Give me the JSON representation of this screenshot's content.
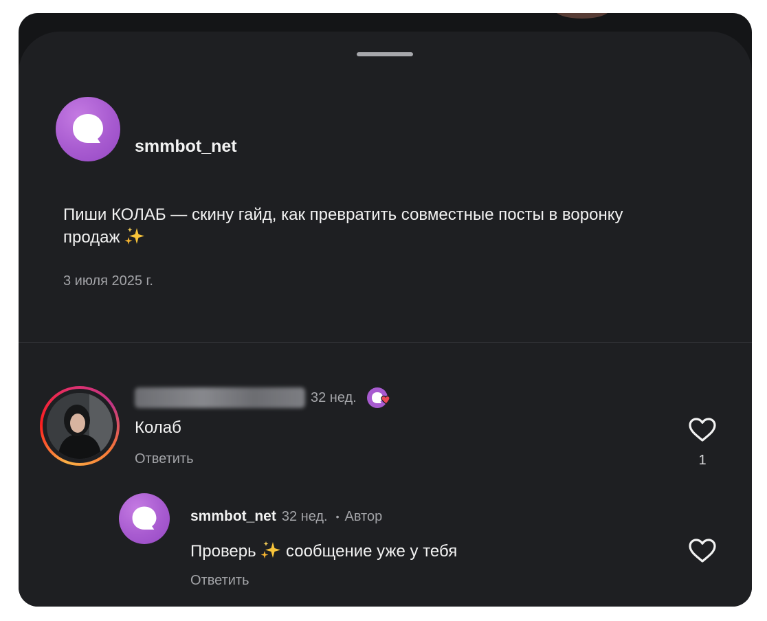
{
  "post": {
    "author": "smmbot_net",
    "text": "Пиши КОЛАБ — скину гайд, как превратить совместные посты в воронку продаж",
    "date": "3 июля 2025 г."
  },
  "comments": [
    {
      "author": "mahabat.marketolog",
      "time": "32 нед.",
      "text": "Колаб",
      "reply_label": "Ответить",
      "likes": "1"
    }
  ],
  "reply": {
    "author": "smmbot_net",
    "time": "32 нед.",
    "separator": "•",
    "author_badge": "Автор",
    "text_before": "Проверь",
    "text_after": "сообщение уже у тебя",
    "reply_label": "Ответить"
  },
  "icons": {
    "brand_logo": "speech-bubble-logo",
    "like": "heart-outline-icon",
    "author_liked": "author-like-badge-icon",
    "emoji": "sparkles-emoji"
  },
  "colors": {
    "brand_purple": "#a85bd0",
    "sheet_background": "#1e1f22",
    "primary_text": "#f2f2f2",
    "secondary_text": "#a3a4a8",
    "like_red": "#ed4956"
  }
}
